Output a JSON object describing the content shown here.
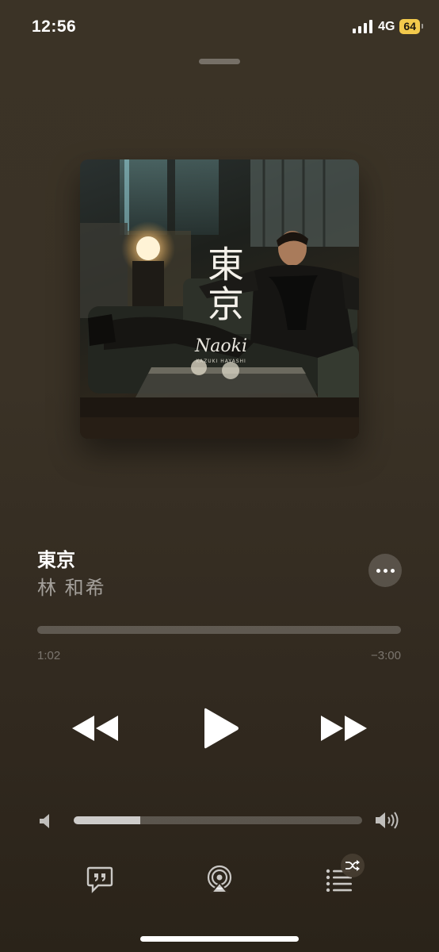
{
  "status_bar": {
    "time": "12:56",
    "network": "4G",
    "battery": "64",
    "battery_color": "#f2c94c"
  },
  "artwork": {
    "title_text": "東京",
    "logo_script": "Naoki",
    "logo_caption": "KAZUKI HAYASHI",
    "icon": "album-artwork"
  },
  "track": {
    "title": "東京",
    "artist": "林 和希"
  },
  "playback": {
    "elapsed": "1:02",
    "remaining": "−3:00",
    "progress_fraction": 0.0
  },
  "controls": {
    "rewind_icon": "rewind-icon",
    "play_icon": "play-icon",
    "forward_icon": "fast-forward-icon",
    "more_icon": "ellipsis-icon"
  },
  "volume": {
    "level_fraction": 0.23,
    "low_icon": "speaker-low-icon",
    "high_icon": "speaker-high-icon"
  },
  "bottom_bar": {
    "lyrics_icon": "lyrics-icon",
    "airplay_icon": "airplay-icon",
    "queue_icon": "queue-list-icon",
    "shuffle_icon": "shuffle-icon"
  }
}
